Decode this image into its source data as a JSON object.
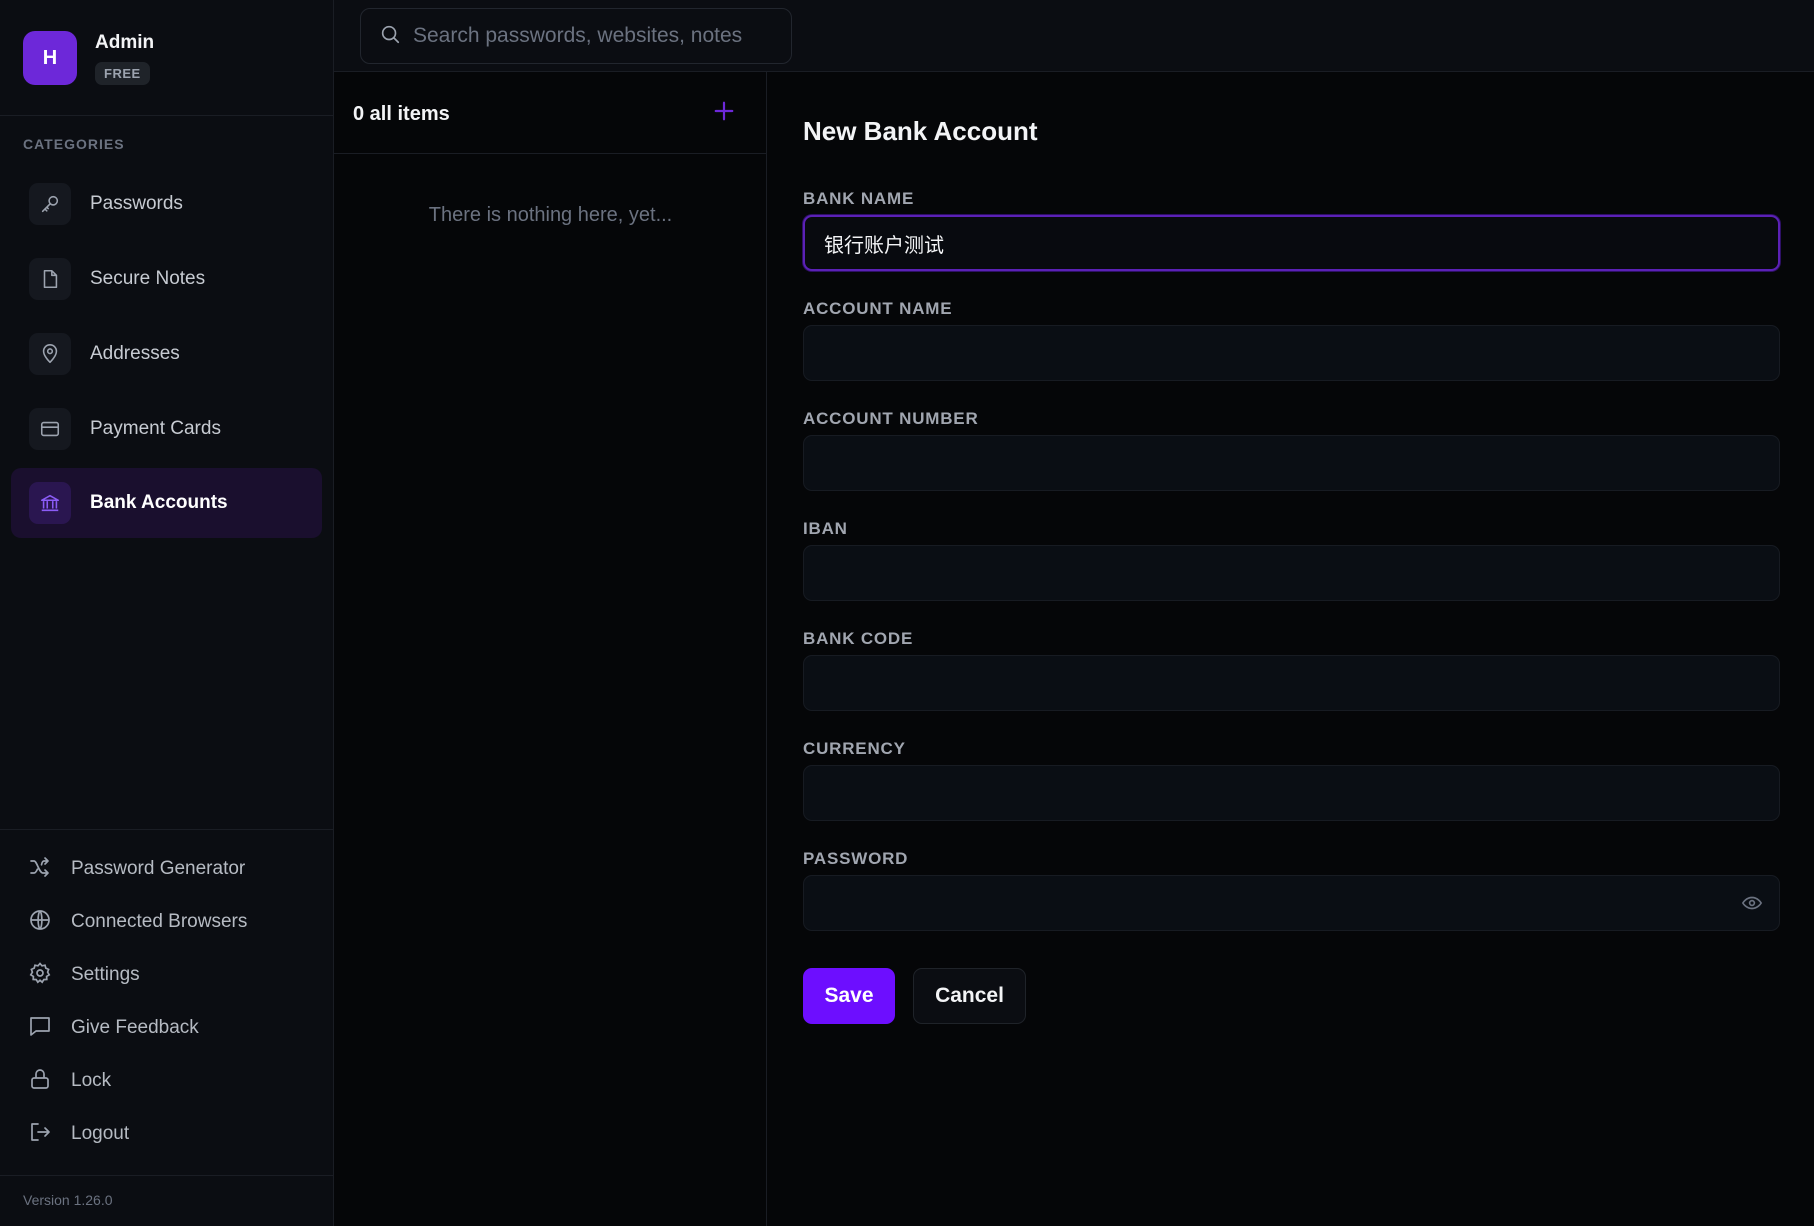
{
  "profile": {
    "initial": "H",
    "name": "Admin",
    "plan": "FREE"
  },
  "sidebar": {
    "categories_heading": "CATEGORIES",
    "categories": [
      {
        "label": "Passwords",
        "icon": "key-icon",
        "active": false
      },
      {
        "label": "Secure Notes",
        "icon": "note-icon",
        "active": false
      },
      {
        "label": "Addresses",
        "icon": "map-pin-icon",
        "active": false
      },
      {
        "label": "Payment Cards",
        "icon": "credit-card-icon",
        "active": false
      },
      {
        "label": "Bank Accounts",
        "icon": "bank-icon",
        "active": true
      }
    ],
    "tools": [
      {
        "label": "Password Generator",
        "icon": "shuffle-icon"
      },
      {
        "label": "Connected Browsers",
        "icon": "globe-icon"
      },
      {
        "label": "Settings",
        "icon": "gear-icon"
      },
      {
        "label": "Give Feedback",
        "icon": "message-icon"
      },
      {
        "label": "Lock",
        "icon": "lock-icon"
      },
      {
        "label": "Logout",
        "icon": "logout-icon"
      }
    ],
    "version": "Version 1.26.0"
  },
  "search": {
    "placeholder": "Search passwords, websites, notes",
    "value": ""
  },
  "list": {
    "count_label": "0 all items",
    "empty_text": "There is nothing here, yet..."
  },
  "form": {
    "title": "New Bank Account",
    "fields": [
      {
        "label": "BANK NAME",
        "value": "银行账户测试",
        "focused": true
      },
      {
        "label": "ACCOUNT NAME",
        "value": ""
      },
      {
        "label": "ACCOUNT NUMBER",
        "value": ""
      },
      {
        "label": "IBAN",
        "value": ""
      },
      {
        "label": "BANK CODE",
        "value": ""
      },
      {
        "label": "CURRENCY",
        "value": ""
      },
      {
        "label": "PASSWORD",
        "value": "",
        "has_toggle": true
      }
    ],
    "save_label": "Save",
    "cancel_label": "Cancel"
  },
  "colors": {
    "accent": "#6d0eff",
    "active_bg": "#1a0f2e",
    "background": "#050608"
  }
}
